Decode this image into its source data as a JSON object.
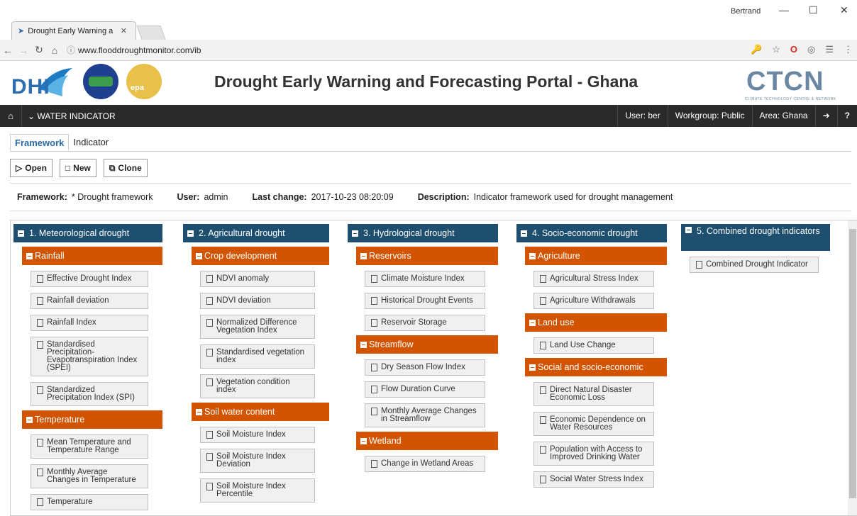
{
  "browser": {
    "tab_title": "Drought Early Warning a",
    "url": "www.flooddroughtmonitor.com/ib",
    "window_user": "Bertrand"
  },
  "portal": {
    "title": "Drought Early Warning and Forecasting Portal - Ghana",
    "logo_dhi": "DHI",
    "logo_ctcn": "CTCN",
    "logo_ctcn_sub": "CLIMATE TECHNOLOGY CENTRE & NETWORK"
  },
  "topnav": {
    "menu": "WATER INDICATOR",
    "user": "User: ber",
    "workgroup": "Workgroup: Public",
    "area": "Area: Ghana"
  },
  "tabs": [
    "Framework",
    "Indicator"
  ],
  "buttons": {
    "open": "Open",
    "new": "New",
    "clone": "Clone"
  },
  "info": {
    "framework_label": "Framework:",
    "framework_value": "* Drought framework",
    "user_label": "User:",
    "user_value": "admin",
    "last_change_label": "Last change:",
    "last_change_value": "2017-10-23 08:20:09",
    "description_label": "Description:",
    "description_value": "Indicator framework used for drought management"
  },
  "columns": [
    {
      "title": "1. Meteorological drought",
      "groups": [
        {
          "name": "Rainfall",
          "items": [
            "Effective Drought Index",
            "Rainfall deviation",
            "Rainfall Index",
            "Standardised Precipitation-Evapotranspiration Index (SPEI)",
            "Standardized Precipitation Index (SPI)"
          ]
        },
        {
          "name": "Temperature",
          "items": [
            "Mean Temperature and Temperature Range",
            "Monthly Average Changes in Temperature",
            "Temperature"
          ]
        }
      ]
    },
    {
      "title": "2. Agricultural drought",
      "groups": [
        {
          "name": "Crop development",
          "items": [
            "NDVI anomaly",
            "NDVI deviation",
            "Normalized Difference Vegetation Index",
            "Standardised vegetation index",
            "Vegetation condition index"
          ]
        },
        {
          "name": "Soil water content",
          "items": [
            "Soil Moisture Index",
            "Soil Moisture Index Deviation",
            "Soil Moisture Index Percentile"
          ]
        }
      ]
    },
    {
      "title": "3. Hydrological drought",
      "groups": [
        {
          "name": "Reservoirs",
          "items": [
            "Climate Moisture Index",
            "Historical Drought Events",
            "Reservoir Storage"
          ]
        },
        {
          "name": "Streamflow",
          "items": [
            "Dry Season Flow Index",
            "Flow Duration Curve",
            "Monthly Average Changes in Streamflow"
          ]
        },
        {
          "name": "Wetland",
          "items": [
            "Change in Wetland Areas"
          ]
        }
      ]
    },
    {
      "title": "4. Socio-economic drought",
      "groups": [
        {
          "name": "Agriculture",
          "items": [
            "Agricultural Stress Index",
            "Agriculture Withdrawals"
          ]
        },
        {
          "name": "Land use",
          "items": [
            "Land Use Change"
          ]
        },
        {
          "name": "Social and socio-economic",
          "items": [
            "Direct Natural Disaster Economic Loss",
            "Economic Dependence on Water Resources",
            "Population with Access to Improved Drinking Water",
            "Social Water Stress Index"
          ]
        }
      ]
    },
    {
      "title": "5. Combined drought indicators",
      "groups": [
        {
          "name": "",
          "items": [
            "Combined Drought Indicator"
          ]
        }
      ]
    }
  ]
}
